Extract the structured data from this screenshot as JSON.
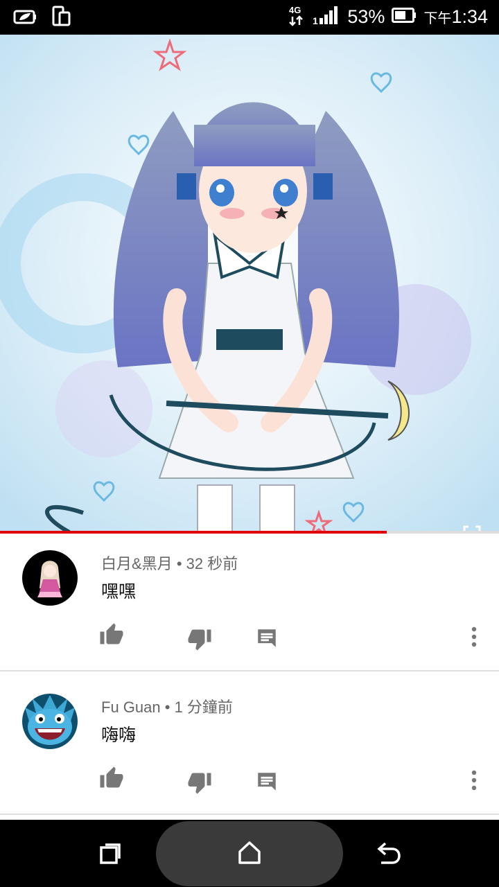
{
  "status_bar": {
    "network": "4G",
    "battery_percent": "53%",
    "time_prefix": "下午",
    "time": "1:34"
  },
  "video": {
    "progress_fraction": 0.775,
    "thumbnail_description_icon": "anime-girl-illustration"
  },
  "comments": [
    {
      "author": "白月&黑月",
      "time": "32 秒前",
      "text": "嘿嘿",
      "avatar": "anime-avatar"
    },
    {
      "author": "Fu Guan",
      "time": "1 分鐘前",
      "text": "嗨嗨",
      "avatar": "blue-creature-avatar"
    }
  ],
  "meta_separator": "•",
  "colors": {
    "progress": "#e00000",
    "icon_gray": "#777777",
    "text_secondary": "#666666"
  }
}
